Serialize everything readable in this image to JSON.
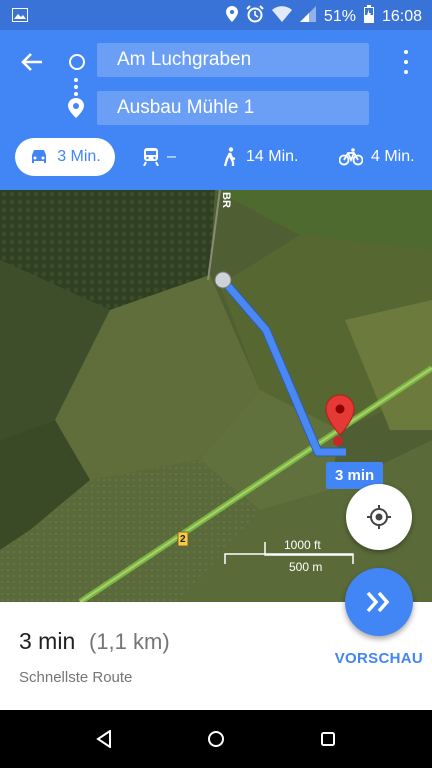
{
  "status_bar": {
    "battery": "51%",
    "time": "16:08"
  },
  "directions": {
    "origin": "Am Luchgraben",
    "destination": "Ausbau Mühle 1"
  },
  "modes": [
    {
      "icon": "car-icon",
      "label": "3 Min.",
      "active": true
    },
    {
      "icon": "train-icon",
      "label": "–",
      "active": false
    },
    {
      "icon": "walking-icon",
      "label": "14 Min.",
      "active": false
    },
    {
      "icon": "bicycle-icon",
      "label": "4 Min.",
      "active": false
    }
  ],
  "map": {
    "route_label": "3 min",
    "road_label_vertical": "BR",
    "road_number": "2",
    "scale_ft": "1000 ft",
    "scale_m": "500 m"
  },
  "summary": {
    "time": "3 min",
    "distance": "(1,1 km)",
    "route_type": "Schnellste Route",
    "preview_button": "VORSCHAU"
  },
  "colors": {
    "primary": "#4285f4",
    "status_bar": "#3a73d8",
    "route": "#4a89f3"
  }
}
